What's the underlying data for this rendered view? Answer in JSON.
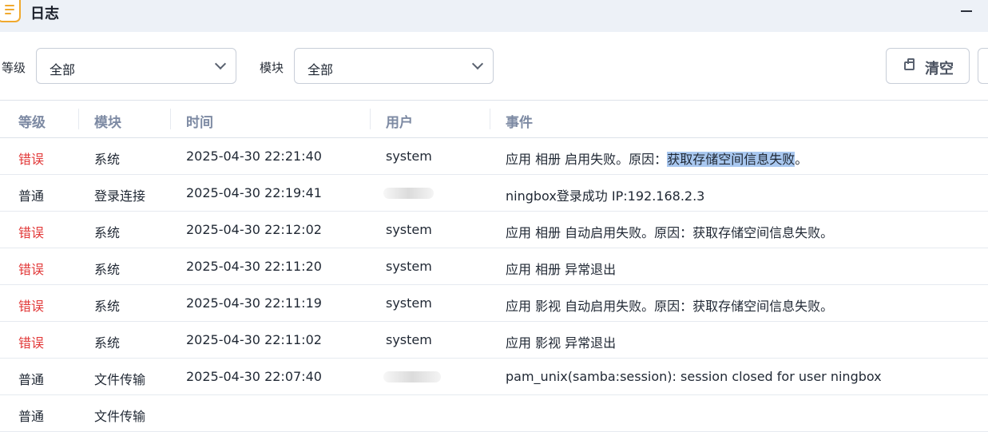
{
  "app": {
    "title": "日志"
  },
  "filters": {
    "level": {
      "label": "等级",
      "value": "全部"
    },
    "module": {
      "label": "模块",
      "value": "全部"
    }
  },
  "toolbar": {
    "clear_label": "清空"
  },
  "table": {
    "headers": [
      "等级",
      "模块",
      "时间",
      "用户",
      "事件"
    ],
    "rows": [
      {
        "level": "错误",
        "level_type": "error",
        "module": "系统",
        "time": "2025-04-30 22:21:40",
        "user": "system",
        "event_prefix": "应用 相册 启用失败。原因：",
        "event_highlight": "获取存储空间信息失败",
        "event_suffix": "。"
      },
      {
        "level": "普通",
        "level_type": "normal",
        "module": "登录连接",
        "time": "2025-04-30 22:19:41",
        "user": "",
        "event_prefix": "ningbox登录成功 IP:192.168.2.3",
        "event_highlight": "",
        "event_suffix": ""
      },
      {
        "level": "错误",
        "level_type": "error",
        "module": "系统",
        "time": "2025-04-30 22:12:02",
        "user": "system",
        "event_prefix": "应用 相册 自动启用失败。原因：获取存储空间信息失败。",
        "event_highlight": "",
        "event_suffix": ""
      },
      {
        "level": "错误",
        "level_type": "error",
        "module": "系统",
        "time": "2025-04-30 22:11:20",
        "user": "system",
        "event_prefix": "应用 相册 异常退出",
        "event_highlight": "",
        "event_suffix": ""
      },
      {
        "level": "错误",
        "level_type": "error",
        "module": "系统",
        "time": "2025-04-30 22:11:19",
        "user": "system",
        "event_prefix": "应用 影视 自动启用失败。原因：获取存储空间信息失败。",
        "event_highlight": "",
        "event_suffix": ""
      },
      {
        "level": "错误",
        "level_type": "error",
        "module": "系统",
        "time": "2025-04-30 22:11:02",
        "user": "system",
        "event_prefix": "应用 影视 异常退出",
        "event_highlight": "",
        "event_suffix": ""
      },
      {
        "level": "普通",
        "level_type": "normal",
        "module": "文件传输",
        "time": "2025-04-30 22:07:40",
        "user": "",
        "event_prefix": "pam_unix(samba:session): session closed for user ningbox",
        "event_highlight": "",
        "event_suffix": ""
      },
      {
        "level": "普通",
        "level_type": "normal",
        "module": "文件传输",
        "time": "",
        "user": "",
        "event_prefix": "",
        "event_highlight": "",
        "event_suffix": ""
      }
    ]
  },
  "colors": {
    "error": "#e23a3a",
    "header": "#7d8aa3",
    "titlebar": "#edf1f7",
    "accent": "#f0a92e"
  },
  "icons": {
    "app": "log-notebook-icon",
    "clear": "trash-box-icon",
    "dropdown": "chevron-down-icon"
  }
}
